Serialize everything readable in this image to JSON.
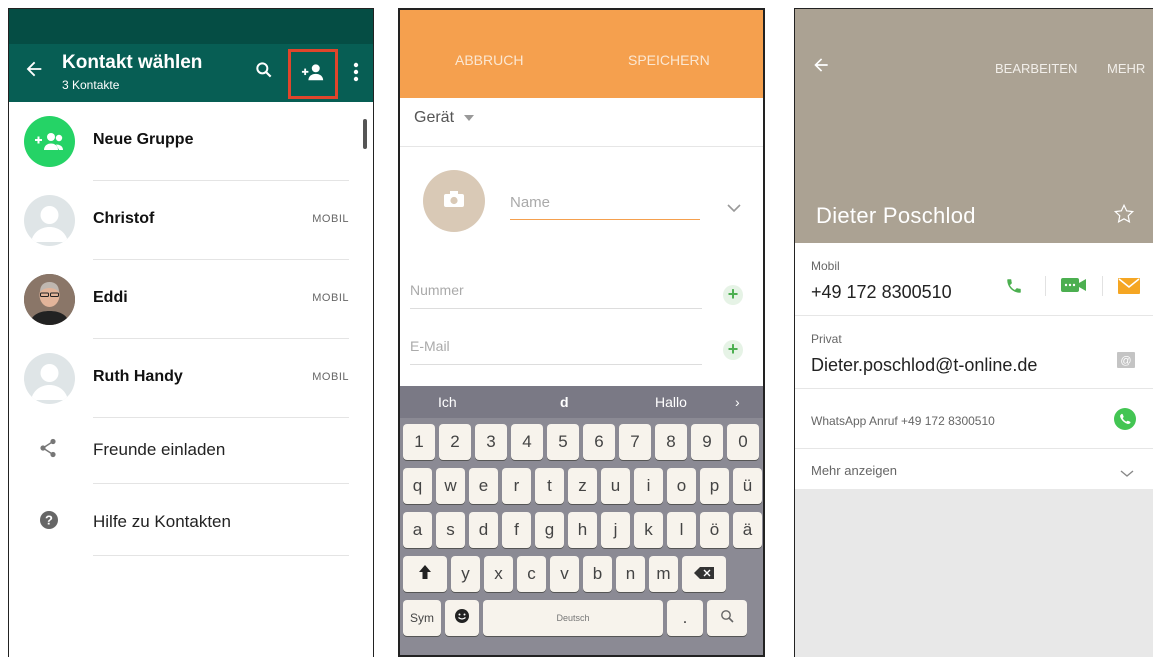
{
  "panel1": {
    "title": "Kontakt wählen",
    "subtitle": "3 Kontakte",
    "rows": [
      {
        "name": "Neue Gruppe"
      },
      {
        "name": "Christof",
        "type": "MOBIL"
      },
      {
        "name": "Eddi",
        "type": "MOBIL"
      },
      {
        "name": "Ruth Handy",
        "type": "MOBIL"
      }
    ],
    "actions": [
      {
        "label": "Freunde einladen",
        "icon": "share-icon"
      },
      {
        "label": "Hilfe zu Kontakten",
        "icon": "help-icon"
      }
    ],
    "colors": {
      "header": "#075e54",
      "accent": "#25d366",
      "highlight": "#e0452b"
    }
  },
  "panel2": {
    "cancel": "ABBRUCH",
    "save": "SPEICHERN",
    "account": "Gerät",
    "name_placeholder": "Name",
    "number_placeholder": "Nummer",
    "email_placeholder": "E-Mail",
    "keyboard": {
      "suggestions": [
        "Ich",
        "d",
        "Hallo"
      ],
      "row1": [
        "1",
        "2",
        "3",
        "4",
        "5",
        "6",
        "7",
        "8",
        "9",
        "0"
      ],
      "row2": [
        "q",
        "w",
        "e",
        "r",
        "t",
        "z",
        "u",
        "i",
        "o",
        "p",
        "ü"
      ],
      "row3": [
        "a",
        "s",
        "d",
        "f",
        "g",
        "h",
        "j",
        "k",
        "l",
        "ö",
        "ä"
      ],
      "row4": [
        "y",
        "x",
        "c",
        "v",
        "b",
        "n",
        "m"
      ],
      "sym": "Sym",
      "space": "Deutsch",
      "period": "."
    },
    "colors": {
      "topbar": "#f5a04e"
    }
  },
  "panel3": {
    "edit": "BEARBEITEN",
    "more": "MEHR",
    "name": "Dieter Poschlod",
    "mobile_label": "Mobil",
    "mobile_number": "+49 172 8300510",
    "private_label": "Privat",
    "email": "Dieter.poschlod@t-online.de",
    "whatsapp_call": "WhatsApp Anruf +49 172 8300510",
    "show_more": "Mehr anzeigen",
    "colors": {
      "header": "#aba293",
      "call": "#4caf50",
      "mail": "#f5a623"
    }
  }
}
